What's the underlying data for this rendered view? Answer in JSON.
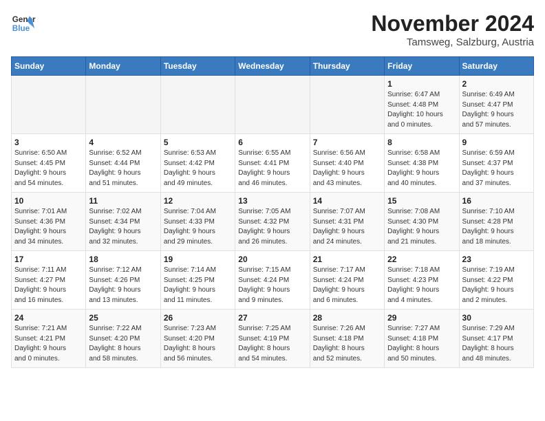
{
  "logo": {
    "line1": "General",
    "line2": "Blue"
  },
  "title": "November 2024",
  "subtitle": "Tamsweg, Salzburg, Austria",
  "days_of_week": [
    "Sunday",
    "Monday",
    "Tuesday",
    "Wednesday",
    "Thursday",
    "Friday",
    "Saturday"
  ],
  "weeks": [
    [
      {
        "day": "",
        "info": ""
      },
      {
        "day": "",
        "info": ""
      },
      {
        "day": "",
        "info": ""
      },
      {
        "day": "",
        "info": ""
      },
      {
        "day": "",
        "info": ""
      },
      {
        "day": "1",
        "info": "Sunrise: 6:47 AM\nSunset: 4:48 PM\nDaylight: 10 hours\nand 0 minutes."
      },
      {
        "day": "2",
        "info": "Sunrise: 6:49 AM\nSunset: 4:47 PM\nDaylight: 9 hours\nand 57 minutes."
      }
    ],
    [
      {
        "day": "3",
        "info": "Sunrise: 6:50 AM\nSunset: 4:45 PM\nDaylight: 9 hours\nand 54 minutes."
      },
      {
        "day": "4",
        "info": "Sunrise: 6:52 AM\nSunset: 4:44 PM\nDaylight: 9 hours\nand 51 minutes."
      },
      {
        "day": "5",
        "info": "Sunrise: 6:53 AM\nSunset: 4:42 PM\nDaylight: 9 hours\nand 49 minutes."
      },
      {
        "day": "6",
        "info": "Sunrise: 6:55 AM\nSunset: 4:41 PM\nDaylight: 9 hours\nand 46 minutes."
      },
      {
        "day": "7",
        "info": "Sunrise: 6:56 AM\nSunset: 4:40 PM\nDaylight: 9 hours\nand 43 minutes."
      },
      {
        "day": "8",
        "info": "Sunrise: 6:58 AM\nSunset: 4:38 PM\nDaylight: 9 hours\nand 40 minutes."
      },
      {
        "day": "9",
        "info": "Sunrise: 6:59 AM\nSunset: 4:37 PM\nDaylight: 9 hours\nand 37 minutes."
      }
    ],
    [
      {
        "day": "10",
        "info": "Sunrise: 7:01 AM\nSunset: 4:36 PM\nDaylight: 9 hours\nand 34 minutes."
      },
      {
        "day": "11",
        "info": "Sunrise: 7:02 AM\nSunset: 4:34 PM\nDaylight: 9 hours\nand 32 minutes."
      },
      {
        "day": "12",
        "info": "Sunrise: 7:04 AM\nSunset: 4:33 PM\nDaylight: 9 hours\nand 29 minutes."
      },
      {
        "day": "13",
        "info": "Sunrise: 7:05 AM\nSunset: 4:32 PM\nDaylight: 9 hours\nand 26 minutes."
      },
      {
        "day": "14",
        "info": "Sunrise: 7:07 AM\nSunset: 4:31 PM\nDaylight: 9 hours\nand 24 minutes."
      },
      {
        "day": "15",
        "info": "Sunrise: 7:08 AM\nSunset: 4:30 PM\nDaylight: 9 hours\nand 21 minutes."
      },
      {
        "day": "16",
        "info": "Sunrise: 7:10 AM\nSunset: 4:28 PM\nDaylight: 9 hours\nand 18 minutes."
      }
    ],
    [
      {
        "day": "17",
        "info": "Sunrise: 7:11 AM\nSunset: 4:27 PM\nDaylight: 9 hours\nand 16 minutes."
      },
      {
        "day": "18",
        "info": "Sunrise: 7:12 AM\nSunset: 4:26 PM\nDaylight: 9 hours\nand 13 minutes."
      },
      {
        "day": "19",
        "info": "Sunrise: 7:14 AM\nSunset: 4:25 PM\nDaylight: 9 hours\nand 11 minutes."
      },
      {
        "day": "20",
        "info": "Sunrise: 7:15 AM\nSunset: 4:24 PM\nDaylight: 9 hours\nand 9 minutes."
      },
      {
        "day": "21",
        "info": "Sunrise: 7:17 AM\nSunset: 4:24 PM\nDaylight: 9 hours\nand 6 minutes."
      },
      {
        "day": "22",
        "info": "Sunrise: 7:18 AM\nSunset: 4:23 PM\nDaylight: 9 hours\nand 4 minutes."
      },
      {
        "day": "23",
        "info": "Sunrise: 7:19 AM\nSunset: 4:22 PM\nDaylight: 9 hours\nand 2 minutes."
      }
    ],
    [
      {
        "day": "24",
        "info": "Sunrise: 7:21 AM\nSunset: 4:21 PM\nDaylight: 9 hours\nand 0 minutes."
      },
      {
        "day": "25",
        "info": "Sunrise: 7:22 AM\nSunset: 4:20 PM\nDaylight: 8 hours\nand 58 minutes."
      },
      {
        "day": "26",
        "info": "Sunrise: 7:23 AM\nSunset: 4:20 PM\nDaylight: 8 hours\nand 56 minutes."
      },
      {
        "day": "27",
        "info": "Sunrise: 7:25 AM\nSunset: 4:19 PM\nDaylight: 8 hours\nand 54 minutes."
      },
      {
        "day": "28",
        "info": "Sunrise: 7:26 AM\nSunset: 4:18 PM\nDaylight: 8 hours\nand 52 minutes."
      },
      {
        "day": "29",
        "info": "Sunrise: 7:27 AM\nSunset: 4:18 PM\nDaylight: 8 hours\nand 50 minutes."
      },
      {
        "day": "30",
        "info": "Sunrise: 7:29 AM\nSunset: 4:17 PM\nDaylight: 8 hours\nand 48 minutes."
      }
    ]
  ]
}
